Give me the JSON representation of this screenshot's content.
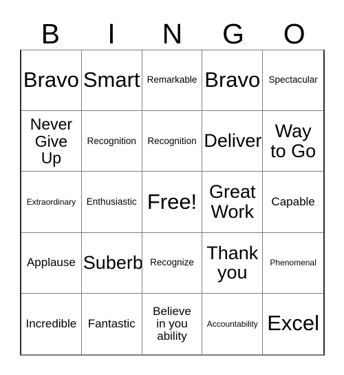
{
  "card": {
    "title": "BINGO",
    "header_letters": [
      "B",
      "I",
      "N",
      "G",
      "O"
    ],
    "grid": {
      "columns": 5,
      "rows": 5,
      "free_space": "Free!",
      "border_color": "#7d7d7d",
      "outer_border_color": "#2b2b2b",
      "background_color": "#ffffff",
      "text_color": "#000000"
    },
    "cells": [
      {
        "text": "Bravo",
        "size": "fs-xxl"
      },
      {
        "text": "Smart",
        "size": "fs-xxl"
      },
      {
        "text": "Remarkable",
        "size": "fs-sm"
      },
      {
        "text": "Bravo",
        "size": "fs-xxl"
      },
      {
        "text": "Spectacular",
        "size": "fs-sm"
      },
      {
        "text": "Never\nGive\nUp",
        "size": "fs-lg"
      },
      {
        "text": "Recognition",
        "size": "fs-sm"
      },
      {
        "text": "Recognition",
        "size": "fs-sm"
      },
      {
        "text": "Deliver",
        "size": "fs-xl"
      },
      {
        "text": "Way\nto Go",
        "size": "fs-xl"
      },
      {
        "text": "Extraordinary",
        "size": "fs-xs"
      },
      {
        "text": "Enthusiastic",
        "size": "fs-sm"
      },
      {
        "text": "Free!",
        "size": "fs-xxl"
      },
      {
        "text": "Great\nWork",
        "size": "fs-xl"
      },
      {
        "text": "Capable",
        "size": "fs-md"
      },
      {
        "text": "Applause",
        "size": "fs-md"
      },
      {
        "text": "Suberb",
        "size": "fs-xl"
      },
      {
        "text": "Recognize",
        "size": "fs-sm"
      },
      {
        "text": "Thank\nyou",
        "size": "fs-xl"
      },
      {
        "text": "Phenomenal",
        "size": "fs-xs"
      },
      {
        "text": "Incredible",
        "size": "fs-md"
      },
      {
        "text": "Fantastic",
        "size": "fs-md"
      },
      {
        "text": "Believe\nin you\nability",
        "size": "fs-md"
      },
      {
        "text": "Accountability",
        "size": "fs-xs"
      },
      {
        "text": "Excel",
        "size": "fs-xxl"
      }
    ]
  }
}
